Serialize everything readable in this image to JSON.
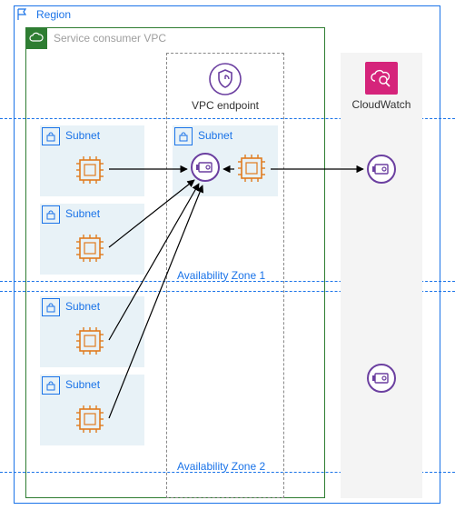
{
  "region": {
    "label": "Region"
  },
  "vpc": {
    "label": "Service consumer VPC"
  },
  "endpoint": {
    "label": "VPC endpoint"
  },
  "cloudwatch": {
    "label": "CloudWatch"
  },
  "az1_label": "Availability Zone 1",
  "az2_label": "Availability Zone 2",
  "subnets": {
    "s1": {
      "label": "Subnet"
    },
    "s2": {
      "label": "Subnet"
    },
    "s3": {
      "label": "Subnet"
    },
    "s4": {
      "label": "Subnet"
    },
    "s5": {
      "label": "Subnet"
    }
  },
  "icons": {
    "flag": "flag-icon",
    "cloud": "cloud-icon",
    "shield": "shield-icon",
    "magnify_cloud": "cloudwatch-icon",
    "lock": "lock-icon",
    "chip": "compute-chip-icon",
    "eni": "network-interface-icon"
  },
  "colors": {
    "aws_blue": "#1a73e8",
    "aws_green": "#2e7d32",
    "aws_orange": "#e07b1e",
    "aws_purple": "#6b3fa0",
    "aws_pink": "#d5247b",
    "subnet_bg": "#e8f2f7",
    "grey_bg": "#f4f4f4"
  }
}
